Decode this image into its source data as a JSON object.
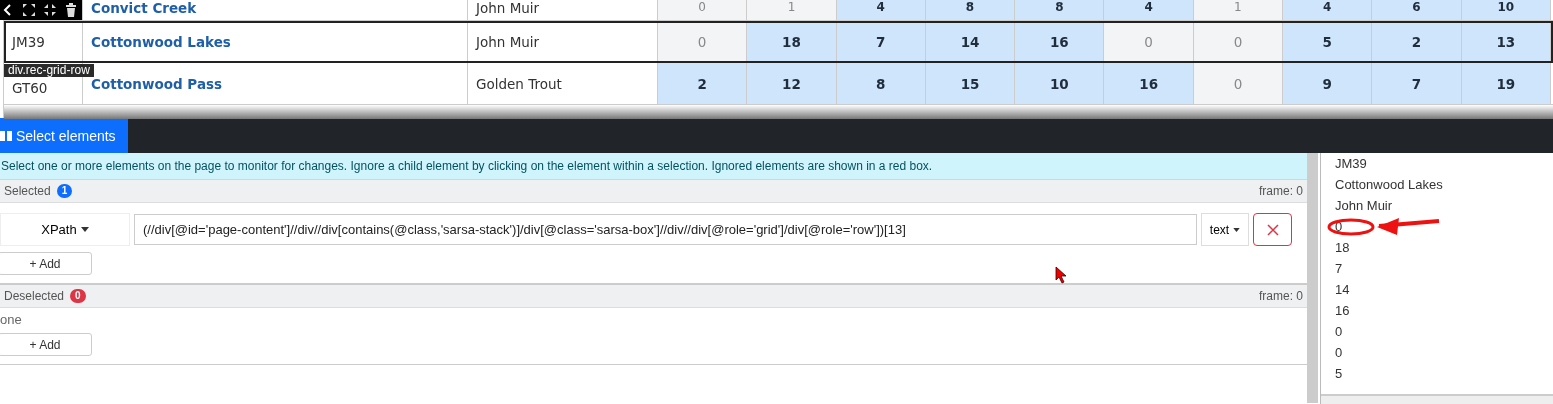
{
  "grid": {
    "rows": [
      {
        "name": "Convict Creek",
        "region": "John Muir",
        "outlined": false,
        "partial": true,
        "cells": [
          {
            "value": "0",
            "highlighted": false
          },
          {
            "value": "1",
            "highlighted": false
          },
          {
            "value": "4",
            "highlighted": true
          },
          {
            "value": "8",
            "highlighted": true
          },
          {
            "value": "8",
            "highlighted": true
          },
          {
            "value": "4",
            "highlighted": true
          },
          {
            "value": "1",
            "highlighted": false
          },
          {
            "value": "4",
            "highlighted": true
          },
          {
            "value": "6",
            "highlighted": true
          },
          {
            "value": "10",
            "highlighted": true
          }
        ]
      },
      {
        "id": "JM39",
        "name": "Cottonwood Lakes",
        "region": "John Muir",
        "outlined": true,
        "partial": false,
        "cells": [
          {
            "value": "0",
            "highlighted": false
          },
          {
            "value": "18",
            "highlighted": true
          },
          {
            "value": "7",
            "highlighted": true
          },
          {
            "value": "14",
            "highlighted": true
          },
          {
            "value": "16",
            "highlighted": true
          },
          {
            "value": "0",
            "highlighted": false
          },
          {
            "value": "0",
            "highlighted": false
          },
          {
            "value": "5",
            "highlighted": true
          },
          {
            "value": "2",
            "highlighted": true
          },
          {
            "value": "13",
            "highlighted": true
          }
        ]
      },
      {
        "id": "GT60",
        "name": "Cottonwood Pass",
        "region": "Golden Trout",
        "outlined": false,
        "partial": false,
        "cells": [
          {
            "value": "2",
            "highlighted": true
          },
          {
            "value": "12",
            "highlighted": true
          },
          {
            "value": "8",
            "highlighted": true
          },
          {
            "value": "15",
            "highlighted": true
          },
          {
            "value": "10",
            "highlighted": true
          },
          {
            "value": "16",
            "highlighted": true
          },
          {
            "value": "0",
            "highlighted": false
          },
          {
            "value": "9",
            "highlighted": true
          },
          {
            "value": "7",
            "highlighted": true
          },
          {
            "value": "19",
            "highlighted": true
          }
        ]
      }
    ]
  },
  "element_label": "div.rec-grid-row",
  "tabs": [
    {
      "label": "Select elements",
      "selected": true
    }
  ],
  "info": "Select one or more elements on the page to monitor for changes. Ignore a child element by clicking on the element within a selection. Ignored elements are shown in a red box.",
  "selected": {
    "title": "Selected",
    "count": "1",
    "frame": "frame: 0",
    "selectors": [
      {
        "type": "XPath",
        "value": "(//div[@id='page-content']//div//div[contains(@class,'sarsa-stack')]/div[@class='sarsa-box']//div//div[@role='grid']/div[@role='row'])[13]",
        "mode": "text"
      }
    ],
    "add": "+ Add"
  },
  "deselected": {
    "title": "Deselected",
    "count": "0",
    "frame": "frame: 0",
    "empty": "one",
    "add": "+ Add"
  },
  "preview": [
    {
      "text": "JM39",
      "annotated": false
    },
    {
      "text": "Cottonwood Lakes",
      "annotated": false
    },
    {
      "text": "John Muir",
      "annotated": false
    },
    {
      "text": "0",
      "annotated": true
    },
    {
      "text": "18",
      "annotated": false
    },
    {
      "text": "7",
      "annotated": false
    },
    {
      "text": "14",
      "annotated": false
    },
    {
      "text": "16",
      "annotated": false
    },
    {
      "text": "0",
      "annotated": false
    },
    {
      "text": "0",
      "annotated": false
    },
    {
      "text": "5",
      "annotated": false
    }
  ]
}
